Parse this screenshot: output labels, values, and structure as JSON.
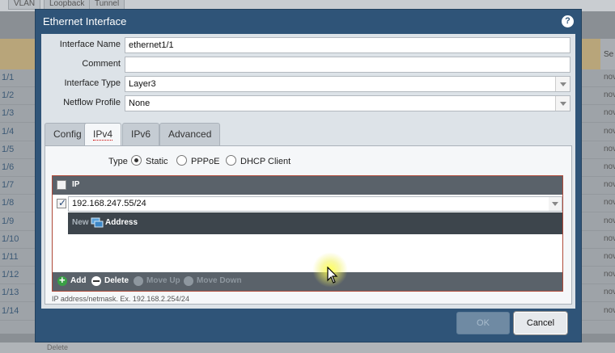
{
  "background": {
    "tabs": [
      "VLAN",
      "Loopback",
      "Tunnel"
    ],
    "header_right": "Se",
    "rows": [
      {
        "name": "1/1",
        "value": "nov"
      },
      {
        "name": "1/2",
        "value": "nov"
      },
      {
        "name": "1/3",
        "value": "nov"
      },
      {
        "name": "1/4",
        "value": "nov"
      },
      {
        "name": "1/5",
        "value": "nov"
      },
      {
        "name": "1/6",
        "value": "nov"
      },
      {
        "name": "1/7",
        "value": "nov"
      },
      {
        "name": "1/8",
        "value": "nov"
      },
      {
        "name": "1/9",
        "value": "nov"
      },
      {
        "name": "1/10",
        "value": "nov"
      },
      {
        "name": "1/11",
        "value": "nov"
      },
      {
        "name": "1/12",
        "value": "nov"
      },
      {
        "name": "1/13",
        "value": "nov"
      },
      {
        "name": "1/14",
        "value": "nov"
      }
    ],
    "footer": "Delete"
  },
  "dialog": {
    "title": "Ethernet Interface",
    "help_icon": "help-icon",
    "fields": {
      "interface_name": {
        "label": "Interface Name",
        "value": "ethernet1/1"
      },
      "comment": {
        "label": "Comment",
        "value": ""
      },
      "interface_type": {
        "label": "Interface Type",
        "value": "Layer3"
      },
      "netflow_profile": {
        "label": "Netflow Profile",
        "value": "None"
      }
    },
    "tabs": [
      {
        "label": "Config",
        "active": false
      },
      {
        "label": "IPv4",
        "active": true
      },
      {
        "label": "IPv6",
        "active": false
      },
      {
        "label": "Advanced",
        "active": false
      }
    ],
    "type": {
      "label": "Type",
      "options": [
        {
          "label": "Static",
          "selected": true
        },
        {
          "label": "PPPoE",
          "selected": false
        },
        {
          "label": "DHCP Client",
          "selected": false
        }
      ]
    },
    "ip_grid": {
      "header": "IP",
      "rows": [
        {
          "value": "192.168.247.55/24",
          "checked": true
        }
      ],
      "dropdown": {
        "new_label": "New",
        "item_label": "Address",
        "item_icon": "address-object-icon"
      },
      "footer": {
        "add": "Add",
        "delete": "Delete",
        "move_up": "Move Up",
        "move_down": "Move Down"
      }
    },
    "hint": "IP address/netmask. Ex. 192.168.2.254/24",
    "buttons": {
      "ok": "OK",
      "cancel": "Cancel"
    }
  }
}
